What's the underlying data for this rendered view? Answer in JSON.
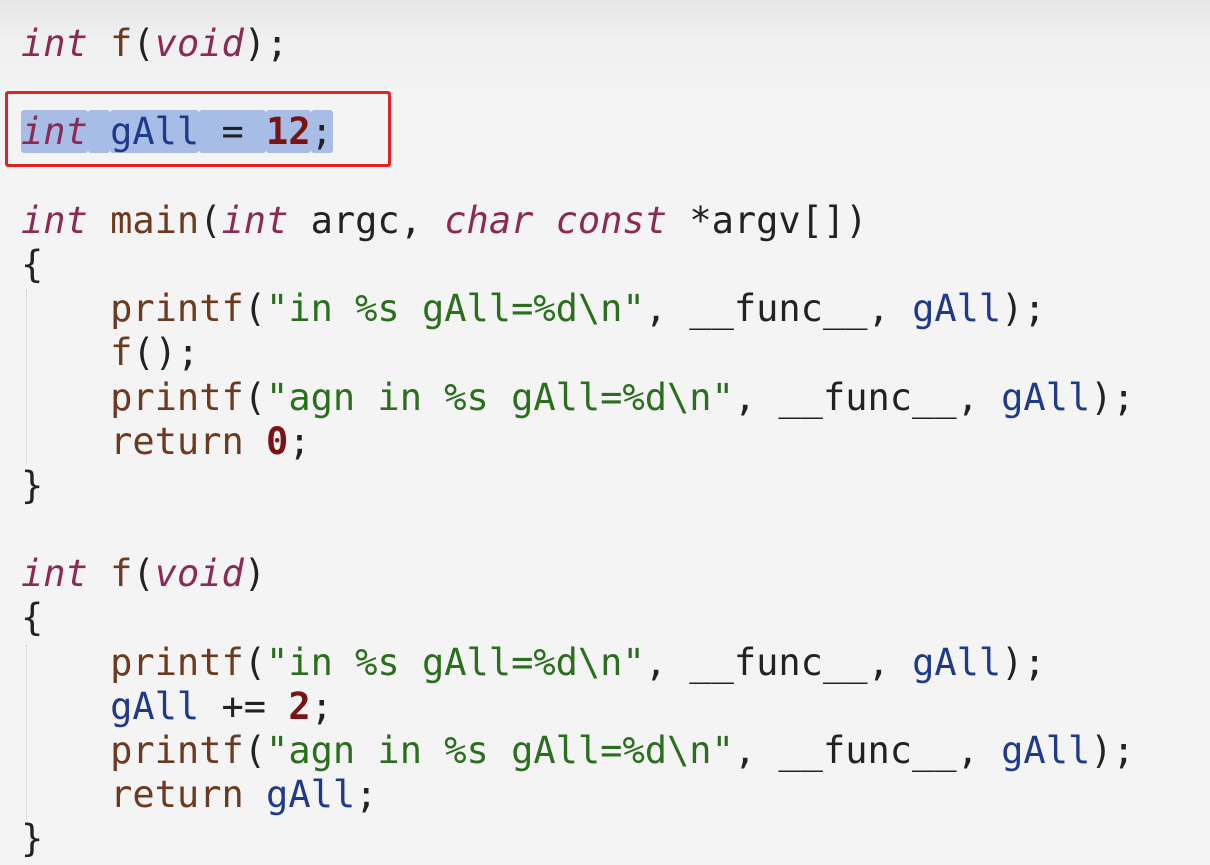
{
  "editor": {
    "lines": [
      {
        "tokens": [
          {
            "t": "int",
            "c": "kw-i"
          },
          {
            "t": " ",
            "c": "plain"
          },
          {
            "t": "f",
            "c": "fn"
          },
          {
            "t": "(",
            "c": "punct"
          },
          {
            "t": "void",
            "c": "kw-i"
          },
          {
            "t": ");",
            "c": "punct"
          }
        ]
      },
      {
        "tokens": []
      },
      {
        "tokens": [
          {
            "t": "int",
            "c": "kw-i sel"
          },
          {
            "t": " ",
            "c": "plain sel"
          },
          {
            "t": "gAll",
            "c": "id sel"
          },
          {
            "t": " = ",
            "c": "punct sel"
          },
          {
            "t": "12",
            "c": "num sel"
          },
          {
            "t": ";",
            "c": "punct sel"
          }
        ]
      },
      {
        "tokens": []
      },
      {
        "tokens": [
          {
            "t": "int",
            "c": "kw-i"
          },
          {
            "t": " ",
            "c": "plain"
          },
          {
            "t": "main",
            "c": "fn"
          },
          {
            "t": "(",
            "c": "punct"
          },
          {
            "t": "int",
            "c": "kw-i"
          },
          {
            "t": " argc, ",
            "c": "plain"
          },
          {
            "t": "char",
            "c": "kw-i"
          },
          {
            "t": " ",
            "c": "plain"
          },
          {
            "t": "const",
            "c": "kw-i"
          },
          {
            "t": " *argv[])",
            "c": "plain"
          }
        ]
      },
      {
        "tokens": [
          {
            "t": "{",
            "c": "punct"
          }
        ]
      },
      {
        "tokens": [
          {
            "t": "    ",
            "c": "plain"
          },
          {
            "t": "printf",
            "c": "fn"
          },
          {
            "t": "(",
            "c": "punct"
          },
          {
            "t": "\"in %s gAll=%d\\n\"",
            "c": "str"
          },
          {
            "t": ", __func__, ",
            "c": "plain"
          },
          {
            "t": "gAll",
            "c": "id"
          },
          {
            "t": ");",
            "c": "punct"
          }
        ]
      },
      {
        "tokens": [
          {
            "t": "    ",
            "c": "plain"
          },
          {
            "t": "f",
            "c": "fn"
          },
          {
            "t": "();",
            "c": "punct"
          }
        ]
      },
      {
        "tokens": [
          {
            "t": "    ",
            "c": "plain"
          },
          {
            "t": "printf",
            "c": "fn"
          },
          {
            "t": "(",
            "c": "punct"
          },
          {
            "t": "\"agn in %s gAll=%d\\n\"",
            "c": "str"
          },
          {
            "t": ", __func__, ",
            "c": "plain"
          },
          {
            "t": "gAll",
            "c": "id"
          },
          {
            "t": ");",
            "c": "punct"
          }
        ]
      },
      {
        "tokens": [
          {
            "t": "    ",
            "c": "plain"
          },
          {
            "t": "return",
            "c": "fn"
          },
          {
            "t": " ",
            "c": "plain"
          },
          {
            "t": "0",
            "c": "num"
          },
          {
            "t": ";",
            "c": "punct"
          }
        ]
      },
      {
        "tokens": [
          {
            "t": "}",
            "c": "punct"
          }
        ]
      },
      {
        "tokens": []
      },
      {
        "tokens": [
          {
            "t": "int",
            "c": "kw-i"
          },
          {
            "t": " ",
            "c": "plain"
          },
          {
            "t": "f",
            "c": "fn"
          },
          {
            "t": "(",
            "c": "punct"
          },
          {
            "t": "void",
            "c": "kw-i"
          },
          {
            "t": ")",
            "c": "punct"
          }
        ]
      },
      {
        "tokens": [
          {
            "t": "{",
            "c": "punct"
          }
        ]
      },
      {
        "tokens": [
          {
            "t": "    ",
            "c": "plain"
          },
          {
            "t": "printf",
            "c": "fn"
          },
          {
            "t": "(",
            "c": "punct"
          },
          {
            "t": "\"in %s gAll=%d\\n\"",
            "c": "str"
          },
          {
            "t": ", __func__, ",
            "c": "plain"
          },
          {
            "t": "gAll",
            "c": "id"
          },
          {
            "t": ");",
            "c": "punct"
          }
        ]
      },
      {
        "tokens": [
          {
            "t": "    ",
            "c": "plain"
          },
          {
            "t": "gAll",
            "c": "id"
          },
          {
            "t": " += ",
            "c": "plain"
          },
          {
            "t": "2",
            "c": "num"
          },
          {
            "t": ";",
            "c": "punct"
          }
        ]
      },
      {
        "tokens": [
          {
            "t": "    ",
            "c": "plain"
          },
          {
            "t": "printf",
            "c": "fn"
          },
          {
            "t": "(",
            "c": "punct"
          },
          {
            "t": "\"agn in %s gAll=%d\\n\"",
            "c": "str"
          },
          {
            "t": ", __func__, ",
            "c": "plain"
          },
          {
            "t": "gAll",
            "c": "id"
          },
          {
            "t": ");",
            "c": "punct"
          }
        ]
      },
      {
        "tokens": [
          {
            "t": "    ",
            "c": "plain"
          },
          {
            "t": "return",
            "c": "fn"
          },
          {
            "t": " ",
            "c": "plain"
          },
          {
            "t": "gAll",
            "c": "id"
          },
          {
            "t": ";",
            "c": "punct"
          }
        ]
      },
      {
        "tokens": [
          {
            "t": "}",
            "c": "punct"
          }
        ]
      }
    ],
    "selected_line": 3,
    "colors": {
      "background": "#f4f4f4",
      "keyword": "#8b2b55",
      "function": "#6b3a1f",
      "identifier": "#1f3a8a",
      "string": "#2a6e1e",
      "number": "#7a1414",
      "selection": "#a7bde6",
      "highlight_box": "#e02424"
    }
  }
}
